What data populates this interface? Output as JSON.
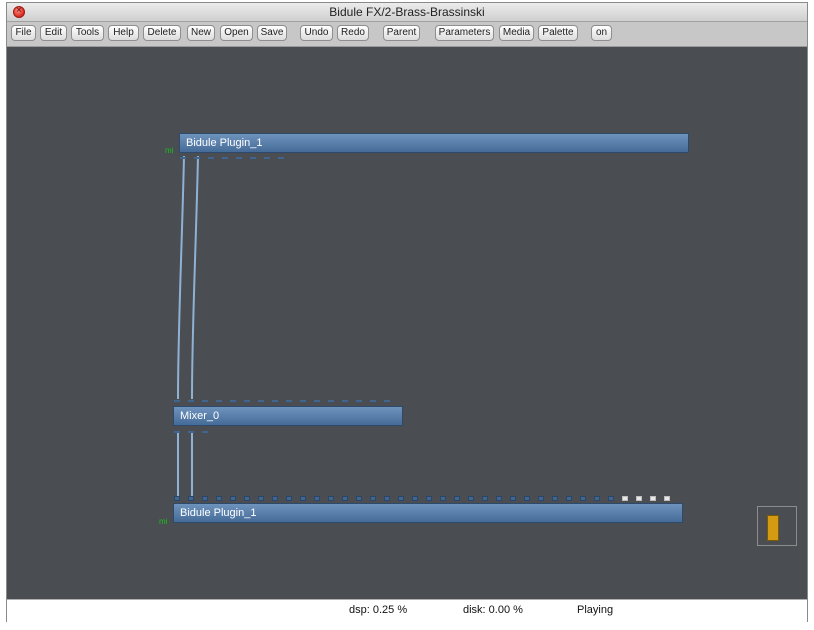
{
  "window": {
    "title": "Bidule FX/2-Brass-Brassinski",
    "close_glyph": "×"
  },
  "toolbar": {
    "buttons": [
      "File",
      "Edit",
      "Tools",
      "Help",
      "Delete",
      "New",
      "Open",
      "Save",
      "Undo",
      "Redo",
      "Parent",
      "Parameters",
      "Media",
      "Palette",
      "on"
    ]
  },
  "nodes": {
    "top": {
      "label": "Bidule Plugin_1",
      "midi": "mi"
    },
    "mixer": {
      "label": "Mixer_0"
    },
    "bottom": {
      "label": "Bidule Plugin_1",
      "midi": "mi"
    }
  },
  "status": {
    "dsp": "dsp:  0.25 %",
    "disk": "disk:  0.00 %",
    "state": "Playing"
  },
  "colors": {
    "canvas": "#4a4d52",
    "node": "#5b80aa",
    "meter": "#d39a12",
    "midi": "#16c416"
  }
}
